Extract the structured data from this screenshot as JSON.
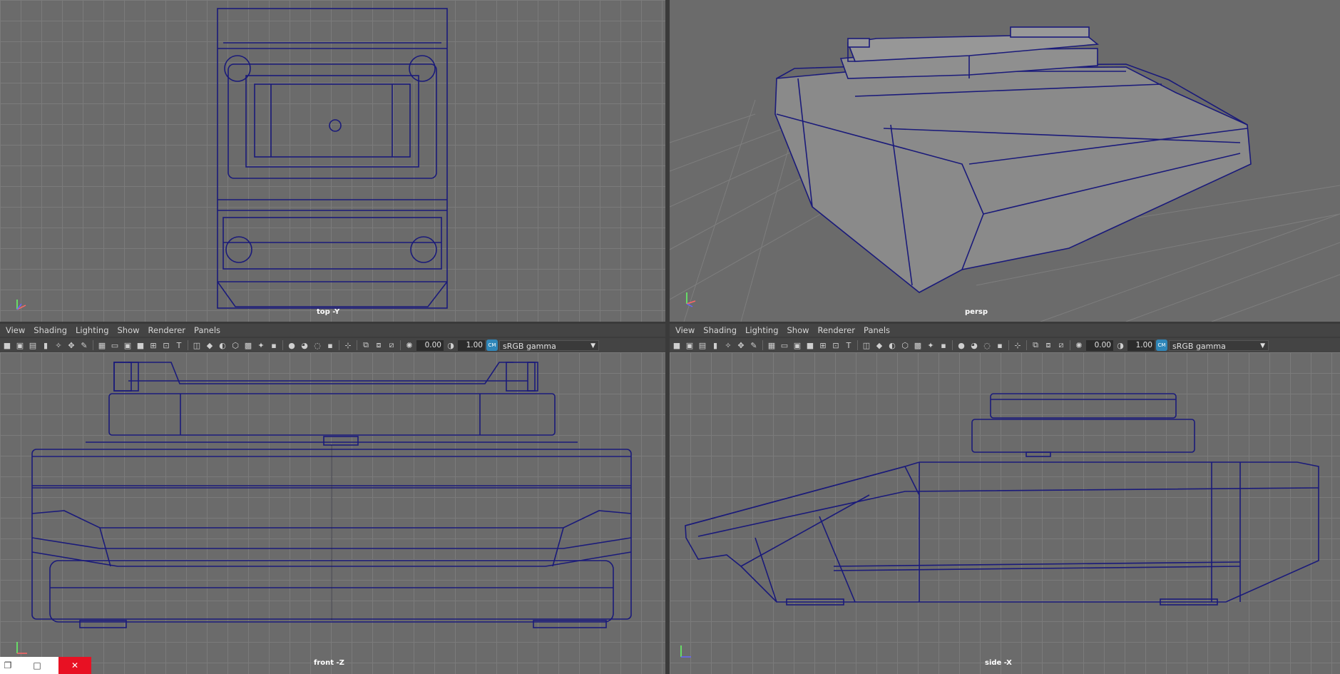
{
  "viewports": {
    "top": {
      "label": "top -Y"
    },
    "persp": {
      "label": "persp"
    },
    "front": {
      "label": "front -Z"
    },
    "side": {
      "label": "side -X"
    }
  },
  "menus": {
    "left": [
      "View",
      "Shading",
      "Lighting",
      "Show",
      "Renderer",
      "Panels"
    ],
    "right": [
      "View",
      "Shading",
      "Lighting",
      "Show",
      "Renderer",
      "Panels"
    ]
  },
  "toolbar": {
    "exposure_value": "0.00",
    "gamma_value": "1.00",
    "color_space": "sRGB gamma",
    "gamma_icon_label": "CM"
  },
  "icons": {
    "camera": "camera-icon",
    "grid": "grid-icon",
    "wireframe": "wireframe-shading-icon",
    "dropdown": "chevron-down-icon",
    "close": "close-icon",
    "maximize": "maximize-icon",
    "restore": "restore-icon"
  },
  "colors": {
    "wire": "#1a1a7a",
    "viewport_bg": "#6b6b6b",
    "grid": "#7b7b7b",
    "panel_bg": "#444444",
    "close_red": "#e81123"
  },
  "window_buttons": {
    "restore": "❐",
    "maximize": "□",
    "close": "✕"
  }
}
